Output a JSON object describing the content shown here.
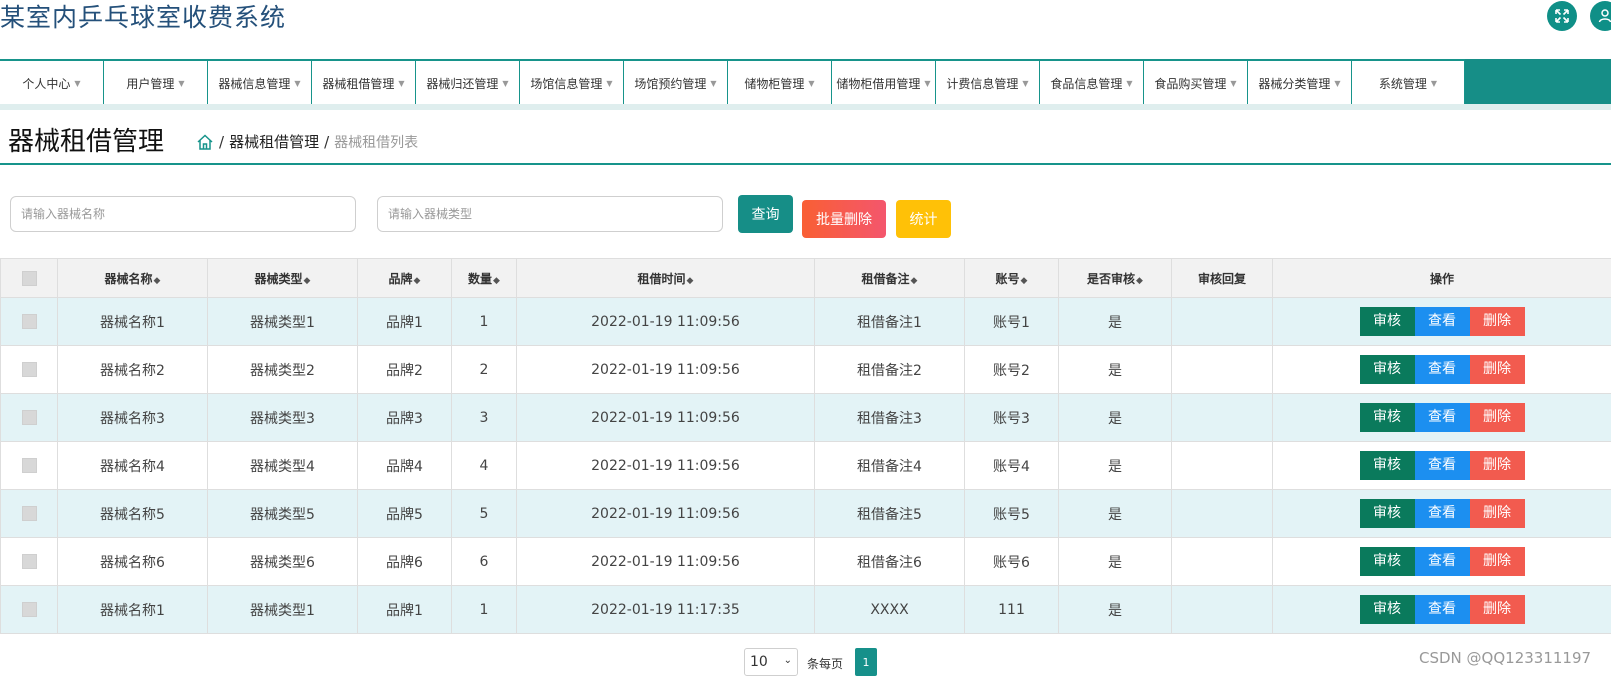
{
  "app": {
    "title": "某室内乒乓球室收费系统"
  },
  "header": {
    "expand_icon": "expand-icon",
    "user_icon": "user-icon"
  },
  "nav": {
    "items": [
      {
        "label": "个人中心"
      },
      {
        "label": "用户管理"
      },
      {
        "label": "器械信息管理"
      },
      {
        "label": "器械租借管理"
      },
      {
        "label": "器械归还管理"
      },
      {
        "label": "场馆信息管理"
      },
      {
        "label": "场馆预约管理"
      },
      {
        "label": "储物柜管理"
      },
      {
        "label": "储物柜借用管理"
      },
      {
        "label": "计费信息管理"
      },
      {
        "label": "食品信息管理"
      },
      {
        "label": "食品购买管理"
      },
      {
        "label": "器械分类管理"
      },
      {
        "label": "系统管理"
      }
    ]
  },
  "page": {
    "title": "器械租借管理",
    "breadcrumb": {
      "home_icon": "home-icon",
      "level1": "器械租借管理",
      "level2": "器械租借列表",
      "separator": "/"
    }
  },
  "search": {
    "name_placeholder": "请输入器械名称",
    "type_placeholder": "请输入器械类型",
    "query_label": "查询",
    "batch_delete_label": "批量删除",
    "stats_label": "统计"
  },
  "table": {
    "columns": [
      "器械名称",
      "器械类型",
      "品牌",
      "数量",
      "租借时间",
      "租借备注",
      "账号",
      "是否审核",
      "审核回复",
      "操作"
    ],
    "sort_glyph": "◆",
    "action_labels": {
      "audit": "审核",
      "view": "查看",
      "delete": "删除"
    },
    "rows": [
      {
        "name": "器械名称1",
        "type": "器械类型1",
        "brand": "品牌1",
        "qty": "1",
        "time": "2022-01-19 11:09:56",
        "note": "租借备注1",
        "account": "账号1",
        "audited": "是",
        "reply": ""
      },
      {
        "name": "器械名称2",
        "type": "器械类型2",
        "brand": "品牌2",
        "qty": "2",
        "time": "2022-01-19 11:09:56",
        "note": "租借备注2",
        "account": "账号2",
        "audited": "是",
        "reply": ""
      },
      {
        "name": "器械名称3",
        "type": "器械类型3",
        "brand": "品牌3",
        "qty": "3",
        "time": "2022-01-19 11:09:56",
        "note": "租借备注3",
        "account": "账号3",
        "audited": "是",
        "reply": ""
      },
      {
        "name": "器械名称4",
        "type": "器械类型4",
        "brand": "品牌4",
        "qty": "4",
        "time": "2022-01-19 11:09:56",
        "note": "租借备注4",
        "account": "账号4",
        "audited": "是",
        "reply": ""
      },
      {
        "name": "器械名称5",
        "type": "器械类型5",
        "brand": "品牌5",
        "qty": "5",
        "time": "2022-01-19 11:09:56",
        "note": "租借备注5",
        "account": "账号5",
        "audited": "是",
        "reply": ""
      },
      {
        "name": "器械名称6",
        "type": "器械类型6",
        "brand": "品牌6",
        "qty": "6",
        "time": "2022-01-19 11:09:56",
        "note": "租借备注6",
        "account": "账号6",
        "audited": "是",
        "reply": ""
      },
      {
        "name": "器械名称1",
        "type": "器械类型1",
        "brand": "品牌1",
        "qty": "1",
        "time": "2022-01-19 11:17:35",
        "note": "XXXX",
        "account": "111",
        "audited": "是",
        "reply": ""
      }
    ]
  },
  "pagination": {
    "page_size": "10",
    "per_page_label": "条每页",
    "current_page": "1"
  },
  "watermark": "CSDN @QQ123311197",
  "colors": {
    "accent": "#168e87",
    "danger": "#f25b4f",
    "warning": "#ffc107",
    "view": "#1c8ff0",
    "audit": "#0a7a5c",
    "row_highlight": "#e3f3f6"
  }
}
